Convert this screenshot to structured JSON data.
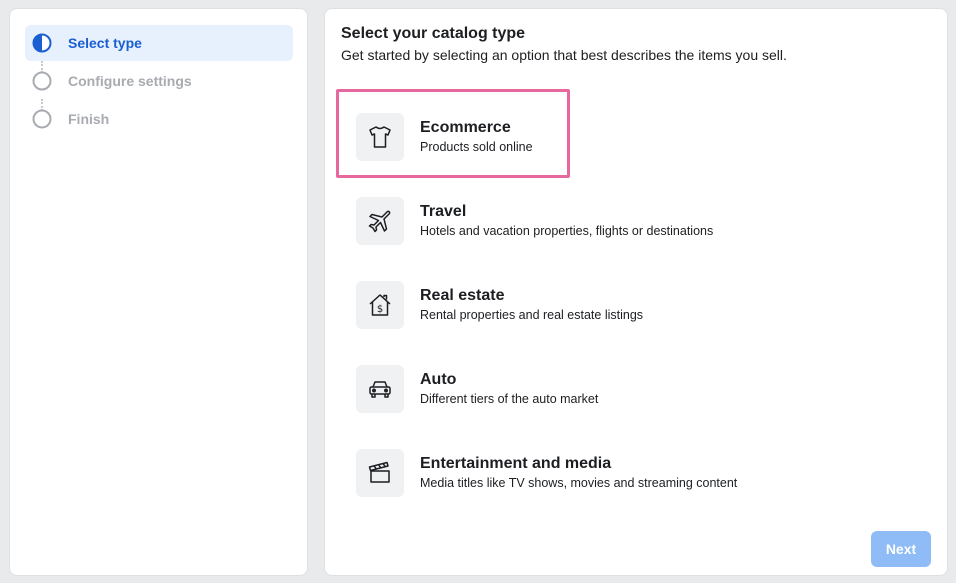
{
  "stepper": {
    "steps": [
      {
        "label": "Select type",
        "state": "active"
      },
      {
        "label": "Configure settings",
        "state": "pending"
      },
      {
        "label": "Finish",
        "state": "pending"
      }
    ]
  },
  "main": {
    "title": "Select your catalog type",
    "subtitle": "Get started by selecting an option that best describes the items you sell.",
    "options": [
      {
        "icon": "tshirt-icon",
        "title": "Ecommerce",
        "description": "Products sold online",
        "highlighted": true
      },
      {
        "icon": "airplane-icon",
        "title": "Travel",
        "description": "Hotels and vacation properties, flights or destinations"
      },
      {
        "icon": "house-dollar-icon",
        "title": "Real estate",
        "description": "Rental properties and real estate listings"
      },
      {
        "icon": "car-icon",
        "title": "Auto",
        "description": "Different tiers of the auto market"
      },
      {
        "icon": "clapperboard-icon",
        "title": "Entertainment and media",
        "description": "Media titles like TV shows, movies and streaming content"
      }
    ],
    "next_label": "Next"
  },
  "colors": {
    "accent": "#1a5fd1",
    "highlight": "#e6689c",
    "next_disabled": "#8fbcf7"
  }
}
